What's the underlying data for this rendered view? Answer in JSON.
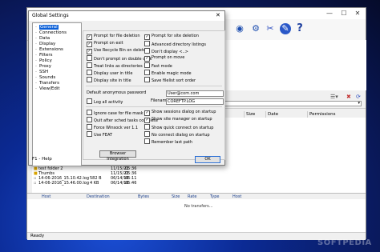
{
  "dialog": {
    "title": "Global Settings",
    "close": "✕",
    "help": "F1 - Help",
    "ok_label": "OK",
    "tree": [
      "General",
      "Connections",
      "Data",
      "Display",
      "Extensions",
      "Filters",
      "Policy",
      "Proxy",
      "SSH",
      "Sounds",
      "Transfers",
      "View/Edit"
    ],
    "left_checks": [
      {
        "label": "Prompt for file deletion",
        "checked": true
      },
      {
        "label": "Prompt on exit",
        "checked": true
      },
      {
        "label": "Use Recycle Bin on delete",
        "checked": true
      },
      {
        "label": "Don't prompt on double click",
        "checked": false
      },
      {
        "label": "Treat links as directories",
        "checked": false
      },
      {
        "label": "Display user in title",
        "checked": false
      },
      {
        "label": "Display site in title",
        "checked": false
      }
    ],
    "right_checks": [
      {
        "label": "Prompt for site deletion",
        "checked": true
      },
      {
        "label": "Advanced directory listings",
        "checked": false
      },
      {
        "label": "Don't display <..>",
        "checked": false
      },
      {
        "label": "Prompt on move",
        "checked": true
      },
      {
        "label": "Fast mode",
        "checked": false
      },
      {
        "label": "Enable magic mode",
        "checked": false
      },
      {
        "label": "Save filelist sort order",
        "checked": false
      }
    ],
    "anon_label": "Default anonymous password",
    "anon_value": "User@com.com",
    "log_label": "Log all activity",
    "log_checked": false,
    "filename_label": "Filename",
    "filename_value": "COREFTP.LOG",
    "bottom_left_checks": [
      {
        "label": "Ignore case for file mask",
        "checked": false
      },
      {
        "label": "Quit after sched tasks complete",
        "checked": false
      },
      {
        "label": "Force Winsock ver 1.1",
        "checked": false
      },
      {
        "label": "Use FEAT",
        "checked": false
      }
    ],
    "bottom_right_checks": [
      {
        "label": "Show sessions dialog on startup",
        "checked": true
      },
      {
        "label": "Show site manager on startup",
        "checked": true
      },
      {
        "label": "Show quick connect on startup",
        "checked": false
      },
      {
        "label": "No connect dialog on startup",
        "checked": false
      },
      {
        "label": "Remember last path",
        "checked": false
      }
    ],
    "browser_button": "Browser Integration"
  },
  "app": {
    "minimize": "—",
    "maximize": "☐",
    "close": "✕",
    "toolbar_icons": [
      "eye-icon",
      "settings-icon",
      "link-icon",
      "edit-icon",
      "help-icon"
    ],
    "toolbar_glyphs": [
      "◉",
      "⚙",
      "✂",
      "✎",
      "?"
    ],
    "remote_columns": [
      "Size",
      "Date",
      "Permissions"
    ],
    "local_files": [
      {
        "name": "test folder 2",
        "date": "11/15/21",
        "time": "05:36"
      },
      {
        "name": "Thumbs",
        "date": "11/15/21",
        "time": "05:36"
      },
      {
        "name": "14-06-2016_15.10.42.log",
        "size": "582 B",
        "date": "06/14/16",
        "time": "05:11"
      },
      {
        "name": "14-06-2016_15.46.00.log",
        "size": "4 KB",
        "date": "06/14/16",
        "time": "05:46"
      }
    ],
    "queue_columns": [
      "Host",
      "Destination",
      "Bytes",
      "Size",
      "Rate",
      "Type",
      "Host"
    ],
    "no_transfers": "No transfers...",
    "status": "Ready",
    "watermark": "SOFTPEDIA"
  }
}
